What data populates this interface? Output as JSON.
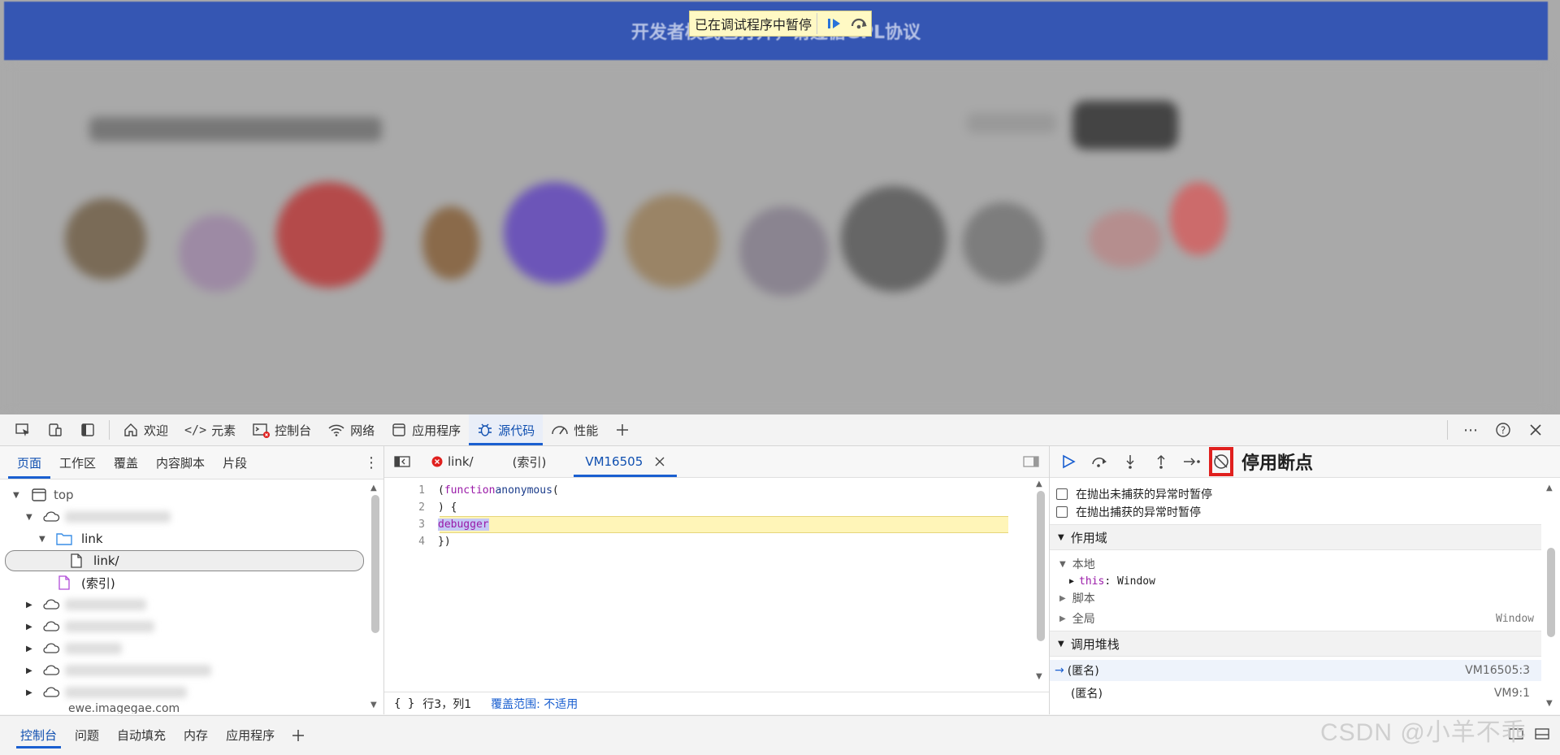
{
  "page": {
    "banner_text": "开发者模式已打开，请遵循GPL协议",
    "pause_notice": "已在调试程序中暂停"
  },
  "devtools": {
    "tabs": [
      {
        "label": "欢迎",
        "icon": "home-icon"
      },
      {
        "label": "元素",
        "icon": "code-icon"
      },
      {
        "label": "控制台",
        "icon": "console-icon"
      },
      {
        "label": "网络",
        "icon": "wifi-icon"
      },
      {
        "label": "应用程序",
        "icon": "app-icon"
      },
      {
        "label": "源代码",
        "icon": "bug-icon",
        "active": true
      },
      {
        "label": "性能",
        "icon": "gauge-icon"
      }
    ]
  },
  "navigator": {
    "tabs": [
      "页面",
      "工作区",
      "覆盖",
      "内容脚本",
      "片段"
    ],
    "tree": {
      "top": "top",
      "folder": "link",
      "file_selected": "link/",
      "file_index": "(索引)",
      "partial_last": "ewe.imagegae.com"
    }
  },
  "editor": {
    "tabs": [
      {
        "label": "link/",
        "error": true
      },
      {
        "label": "(索引)"
      },
      {
        "label": "VM16505",
        "active": true
      }
    ],
    "lines": [
      {
        "no": "1",
        "parts": [
          "(",
          "function",
          " ",
          "anonymous",
          "("
        ]
      },
      {
        "no": "2",
        "text": ") {"
      },
      {
        "no": "3",
        "text": "debugger",
        "paused": true
      },
      {
        "no": "4",
        "text": "})"
      }
    ],
    "status": {
      "braces": "{ }",
      "position": "行3，列1",
      "coverage_label": "覆盖范围:",
      "coverage_value": "不适用"
    }
  },
  "debugger": {
    "deactivate_label": "停用断点",
    "pause_uncaught": "在抛出未捕获的异常时暂停",
    "pause_caught": "在抛出捕获的异常时暂停",
    "scope_title": "作用域",
    "scope": {
      "local": "本地",
      "this_key": "this",
      "this_value": "Window",
      "script": "脚本",
      "global": "全局",
      "global_value": "Window"
    },
    "callstack_title": "调用堆栈",
    "callstack": [
      {
        "name": "(匿名)",
        "location": "VM16505:3",
        "current": true
      },
      {
        "name": "(匿名)",
        "location": "VM9:1"
      }
    ]
  },
  "drawer": {
    "tabs": [
      "控制台",
      "问题",
      "自动填充",
      "内存",
      "应用程序"
    ]
  },
  "watermark": "CSDN @小羊不乖",
  "colors": {
    "accent": "#1a5fd0",
    "banner": "#3556b3",
    "highlight": "#e0201e",
    "paused_line": "#fff5b8"
  }
}
